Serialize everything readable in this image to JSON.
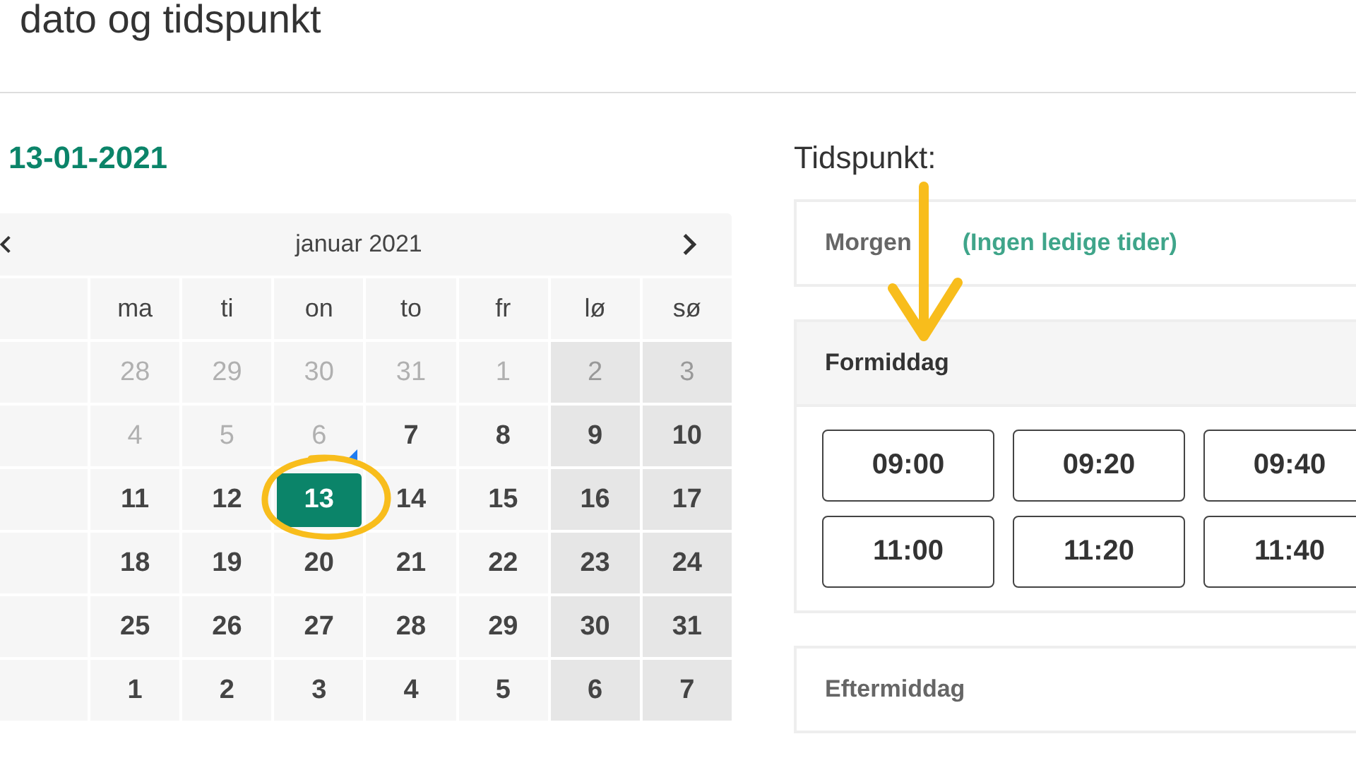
{
  "title": "dato og tidspunkt",
  "selected_date": "13-01-2021",
  "calendar": {
    "month_label": "januar 2021",
    "weekdays": [
      {
        "label": "ma",
        "weekend": false
      },
      {
        "label": "ti",
        "weekend": false
      },
      {
        "label": "on",
        "weekend": false
      },
      {
        "label": "to",
        "weekend": false
      },
      {
        "label": "fr",
        "weekend": false
      },
      {
        "label": "lø",
        "weekend": true
      },
      {
        "label": "sø",
        "weekend": true
      }
    ],
    "weeks": [
      [
        {
          "day": "28",
          "muted": true,
          "selected": false,
          "today": false
        },
        {
          "day": "29",
          "muted": true,
          "selected": false,
          "today": false
        },
        {
          "day": "30",
          "muted": true,
          "selected": false,
          "today": false
        },
        {
          "day": "31",
          "muted": true,
          "selected": false,
          "today": false
        },
        {
          "day": "1",
          "muted": true,
          "selected": false,
          "today": false
        },
        {
          "day": "2",
          "muted": true,
          "selected": false,
          "today": false
        },
        {
          "day": "3",
          "muted": true,
          "selected": false,
          "today": false
        }
      ],
      [
        {
          "day": "4",
          "muted": true,
          "selected": false,
          "today": false
        },
        {
          "day": "5",
          "muted": true,
          "selected": false,
          "today": false
        },
        {
          "day": "6",
          "muted": true,
          "selected": false,
          "today": true
        },
        {
          "day": "7",
          "muted": false,
          "selected": false,
          "today": false
        },
        {
          "day": "8",
          "muted": false,
          "selected": false,
          "today": false
        },
        {
          "day": "9",
          "muted": false,
          "selected": false,
          "today": false
        },
        {
          "day": "10",
          "muted": false,
          "selected": false,
          "today": false
        }
      ],
      [
        {
          "day": "11",
          "muted": false,
          "selected": false,
          "today": false
        },
        {
          "day": "12",
          "muted": false,
          "selected": false,
          "today": false
        },
        {
          "day": "13",
          "muted": false,
          "selected": true,
          "today": false
        },
        {
          "day": "14",
          "muted": false,
          "selected": false,
          "today": false
        },
        {
          "day": "15",
          "muted": false,
          "selected": false,
          "today": false
        },
        {
          "day": "16",
          "muted": false,
          "selected": false,
          "today": false
        },
        {
          "day": "17",
          "muted": false,
          "selected": false,
          "today": false
        }
      ],
      [
        {
          "day": "18",
          "muted": false,
          "selected": false,
          "today": false
        },
        {
          "day": "19",
          "muted": false,
          "selected": false,
          "today": false
        },
        {
          "day": "20",
          "muted": false,
          "selected": false,
          "today": false
        },
        {
          "day": "21",
          "muted": false,
          "selected": false,
          "today": false
        },
        {
          "day": "22",
          "muted": false,
          "selected": false,
          "today": false
        },
        {
          "day": "23",
          "muted": false,
          "selected": false,
          "today": false
        },
        {
          "day": "24",
          "muted": false,
          "selected": false,
          "today": false
        }
      ],
      [
        {
          "day": "25",
          "muted": false,
          "selected": false,
          "today": false
        },
        {
          "day": "26",
          "muted": false,
          "selected": false,
          "today": false
        },
        {
          "day": "27",
          "muted": false,
          "selected": false,
          "today": false
        },
        {
          "day": "28",
          "muted": false,
          "selected": false,
          "today": false
        },
        {
          "day": "29",
          "muted": false,
          "selected": false,
          "today": false
        },
        {
          "day": "30",
          "muted": false,
          "selected": false,
          "today": false
        },
        {
          "day": "31",
          "muted": false,
          "selected": false,
          "today": false
        }
      ],
      [
        {
          "day": "1",
          "muted": false,
          "selected": false,
          "today": false
        },
        {
          "day": "2",
          "muted": false,
          "selected": false,
          "today": false
        },
        {
          "day": "3",
          "muted": false,
          "selected": false,
          "today": false
        },
        {
          "day": "4",
          "muted": false,
          "selected": false,
          "today": false
        },
        {
          "day": "5",
          "muted": false,
          "selected": false,
          "today": false
        },
        {
          "day": "6",
          "muted": false,
          "selected": false,
          "today": false
        },
        {
          "day": "7",
          "muted": false,
          "selected": false,
          "today": false
        }
      ]
    ]
  },
  "time": {
    "label": "Tidspunkt:",
    "sections": [
      {
        "title": "Morgen",
        "note": "(Ingen ledige tider)",
        "expanded": false
      },
      {
        "title": "Formiddag",
        "expanded": true,
        "slots": [
          "09:00",
          "09:20",
          "09:40",
          "11:00",
          "11:20",
          "11:40"
        ]
      },
      {
        "title": "Eftermiddag",
        "expanded": false
      }
    ]
  }
}
